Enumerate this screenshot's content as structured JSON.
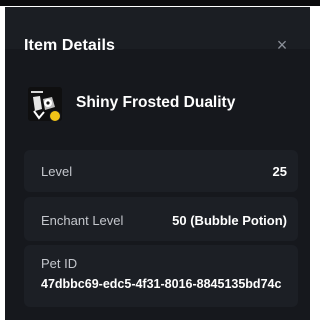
{
  "modal": {
    "title": "Item Details",
    "close_icon": "×"
  },
  "item": {
    "name": "Shiny Frosted Duality",
    "icon": "pet-thumbnail",
    "badge_color": "#f2c418"
  },
  "details": {
    "level_label": "Level",
    "level_value": "25",
    "enchant_label": "Enchant Level",
    "enchant_value": "50 (Bubble Potion)",
    "pet_id_label": "Pet ID",
    "pet_id_value": "47dbbc69-edc5-4f31-8016-8845135bd74c"
  },
  "colors": {
    "modal_bg": "#16181d",
    "card_bg": "#1c1f25",
    "text_primary": "#ffffff",
    "text_secondary": "#c4c7cd"
  }
}
